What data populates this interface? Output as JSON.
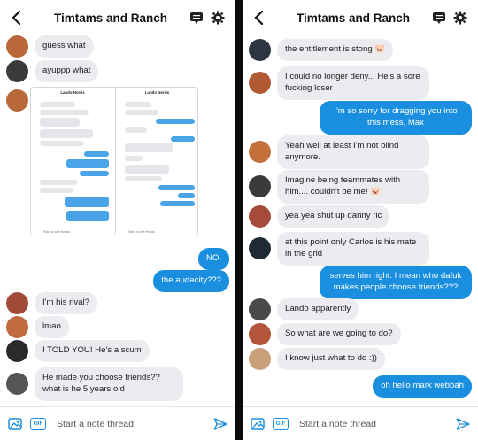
{
  "left": {
    "title": "Timtams and Ranch",
    "messages": [
      {
        "text": "guess what",
        "dir": "in",
        "avatar": "#b9683a"
      },
      {
        "text": "ayuppp what",
        "dir": "in",
        "avatar": "#3a3a3a"
      },
      {
        "text": "NO.",
        "dir": "out"
      },
      {
        "text": "the audacity???",
        "dir": "out"
      },
      {
        "text": "I'm his rival?",
        "dir": "in",
        "avatar": "#a04b37"
      },
      {
        "text": "lmao",
        "dir": "in",
        "avatar": "#c26a40"
      },
      {
        "text": "I TOLD YOU! He's a scum",
        "dir": "in",
        "avatar": "#2a2a2a"
      },
      {
        "text": "He made you choose friends?? what is he 5 years old",
        "dir": "in",
        "avatar": "#555555"
      }
    ],
    "screenshot": {
      "left_title": "Lando Norris",
      "right_title": "Lando Norris",
      "composer": "Start a note thread"
    },
    "composer_placeholder": "Start a note thread"
  },
  "right": {
    "title": "Timtams and Ranch",
    "messages": [
      {
        "text": "the entitlement is stong 🐷",
        "dir": "in",
        "avatar": "#2c3540"
      },
      {
        "text": "I could no longer deny... He's a sore fucking loser",
        "dir": "in",
        "avatar": "#b05a33"
      },
      {
        "text": "I'm so sorry for dragging you into this mess, Max",
        "dir": "out"
      },
      {
        "text": "Yeah well at least I'm not blind anymore.",
        "dir": "in",
        "avatar": "#c4703a"
      },
      {
        "text": "Imagine being teammates with him.... couldn't be me! 🐷",
        "dir": "in",
        "avatar": "#3b3b3b"
      },
      {
        "text": "yea yea shut up danny ric",
        "dir": "in",
        "avatar": "#a64a3c"
      },
      {
        "text": "at this point only Carlos is his mate in the grid",
        "dir": "in",
        "avatar": "#1f2a35"
      },
      {
        "text": "serves him right. I mean who dafuk makes people choose friends???",
        "dir": "out"
      },
      {
        "text": "Lando apparently",
        "dir": "in",
        "avatar": "#4a4a4a"
      },
      {
        "text": "So what are we going to do?",
        "dir": "in",
        "avatar": "#b2553a"
      },
      {
        "text": "I know just what to do :))",
        "dir": "in",
        "avatar": "#caa07a"
      },
      {
        "text": "oh hello mark webbah",
        "dir": "out"
      }
    ],
    "composer_placeholder": "Start a note thread"
  },
  "colors": {
    "accent": "#1a8fe0",
    "bubble_in": "#ececf0",
    "divider": "#0b0b0b"
  },
  "icons": [
    "back-chevron-icon",
    "notes-icon",
    "gear-icon",
    "image-icon",
    "gif-icon",
    "send-icon"
  ]
}
